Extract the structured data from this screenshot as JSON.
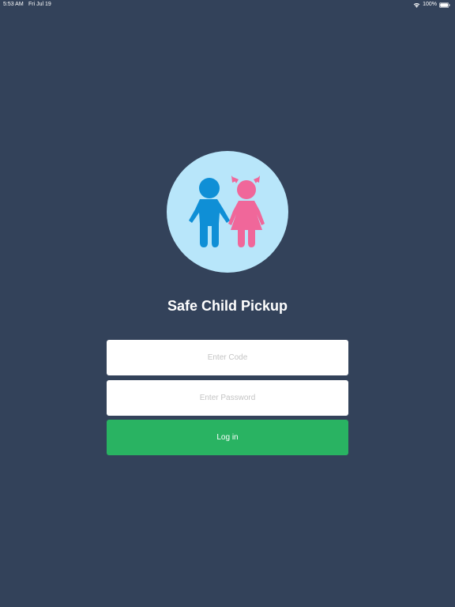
{
  "status_bar": {
    "time": "5:53 AM",
    "date": "Fri Jul 19",
    "battery": "100%"
  },
  "logo": {
    "icon": "boy-and-girl-children-icon",
    "circle_color": "#b8e6fa",
    "boy_color": "#0f8fd6",
    "girl_color": "#f0679a"
  },
  "app_title": "Safe Child Pickup",
  "form": {
    "code_placeholder": "Enter Code",
    "code_value": "",
    "password_placeholder": "Enter Password",
    "password_value": "",
    "login_label": "Log in"
  },
  "colors": {
    "background": "#33425a",
    "button": "#29b362",
    "field": "#ffffff"
  }
}
